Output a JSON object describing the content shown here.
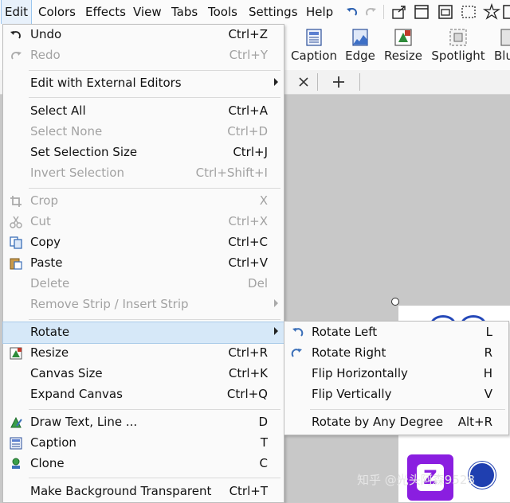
{
  "menubar": {
    "items": [
      "Edit",
      "Colors",
      "Effects",
      "View",
      "Tabs",
      "Tools",
      "Settings",
      "Help"
    ]
  },
  "toolbar": {
    "buttons": [
      "Caption",
      "Edge",
      "Resize",
      "Spotlight",
      "Blu"
    ]
  },
  "edit_menu": {
    "undo": {
      "label": "Undo",
      "shortcut": "Ctrl+Z"
    },
    "redo": {
      "label": "Redo",
      "shortcut": "Ctrl+Y"
    },
    "external": {
      "label": "Edit with External Editors"
    },
    "select_all": {
      "label": "Select All",
      "shortcut": "Ctrl+A"
    },
    "select_none": {
      "label": "Select None",
      "shortcut": "Ctrl+D"
    },
    "set_selection_size": {
      "label": "Set Selection Size",
      "shortcut": "Ctrl+J"
    },
    "invert_selection": {
      "label": "Invert Selection",
      "shortcut": "Ctrl+Shift+I"
    },
    "crop": {
      "label": "Crop",
      "shortcut": "X"
    },
    "cut": {
      "label": "Cut",
      "shortcut": "Ctrl+X"
    },
    "copy": {
      "label": "Copy",
      "shortcut": "Ctrl+C"
    },
    "paste": {
      "label": "Paste",
      "shortcut": "Ctrl+V"
    },
    "delete": {
      "label": "Delete",
      "shortcut": "Del"
    },
    "remove_strip": {
      "label": "Remove Strip / Insert Strip"
    },
    "rotate": {
      "label": "Rotate"
    },
    "resize": {
      "label": "Resize",
      "shortcut": "Ctrl+R"
    },
    "canvas_size": {
      "label": "Canvas Size",
      "shortcut": "Ctrl+K"
    },
    "expand_canvas": {
      "label": "Expand Canvas",
      "shortcut": "Ctrl+Q"
    },
    "draw_text": {
      "label": "Draw Text, Line ...",
      "shortcut": "D"
    },
    "caption": {
      "label": "Caption",
      "shortcut": "T"
    },
    "clone": {
      "label": "Clone",
      "shortcut": "C"
    },
    "make_bg_transparent": {
      "label": "Make Background Transparent",
      "shortcut": "Ctrl+T"
    }
  },
  "rotate_menu": {
    "rotate_left": {
      "label": "Rotate Left",
      "shortcut": "L"
    },
    "rotate_right": {
      "label": "Rotate Right",
      "shortcut": "R"
    },
    "flip_h": {
      "label": "Flip Horizontally",
      "shortcut": "H"
    },
    "flip_v": {
      "label": "Flip Vertically",
      "shortcut": "V"
    },
    "any_degree": {
      "label": "Rotate by Any Degree",
      "shortcut": "Alt+R"
    }
  },
  "watermark": "知乎 @光头阿森9528",
  "colors": {
    "accent_highlight": "#d6e8f8",
    "icon_blue": "#3b6fb8",
    "purple": "#8a1ee0"
  }
}
